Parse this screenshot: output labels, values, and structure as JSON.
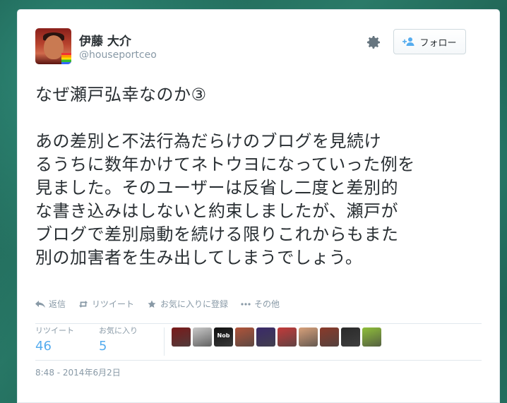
{
  "user": {
    "display_name": "伊藤 大介",
    "handle": "@houseportceo"
  },
  "follow_button": {
    "label": "フォロー"
  },
  "tweet": {
    "title": "なぜ瀬戸弘幸なのか③",
    "body_lines": [
      "あの差別と不法行為だらけのブログを見続け",
      "るうちに数年かけてネトウヨになっていった例を",
      "見ました。そのユーザーは反省し二度と差別的",
      "な書き込みはしないと約束しましたが、瀬戸が",
      "ブログで差別扇動を続ける限りこれからもまた",
      "別の加害者を生み出してしまうでしょう。"
    ]
  },
  "actions": {
    "reply": "返信",
    "retweet": "リツイート",
    "favorite": "お気に入りに登録",
    "more": "その他"
  },
  "stats": {
    "retweets_label": "リツイート",
    "retweets_count": "46",
    "favorites_label": "お気に入り",
    "favorites_count": "5"
  },
  "favoriters": [
    {
      "color": "#7a1a1a",
      "icon": "avatar"
    },
    {
      "color": "#c9c9c9",
      "icon": "avatar"
    },
    {
      "color": "#111111",
      "icon": "avatar-nob",
      "text": "Nob"
    },
    {
      "color": "#b0543a",
      "icon": "avatar"
    },
    {
      "color": "#3a2a6a",
      "icon": "avatar"
    },
    {
      "color": "#c33a3a",
      "icon": "avatar"
    },
    {
      "color": "#d7a07a",
      "icon": "avatar"
    },
    {
      "color": "#8a3a2a",
      "icon": "avatar"
    },
    {
      "color": "#2a2a2a",
      "icon": "avatar"
    },
    {
      "color": "#8fbf3a",
      "icon": "avatar"
    }
  ],
  "timestamp": "8:48 - 2014年6月2日",
  "colors": {
    "accent": "#55acee",
    "text": "#292f33",
    "muted": "#8899a6"
  }
}
